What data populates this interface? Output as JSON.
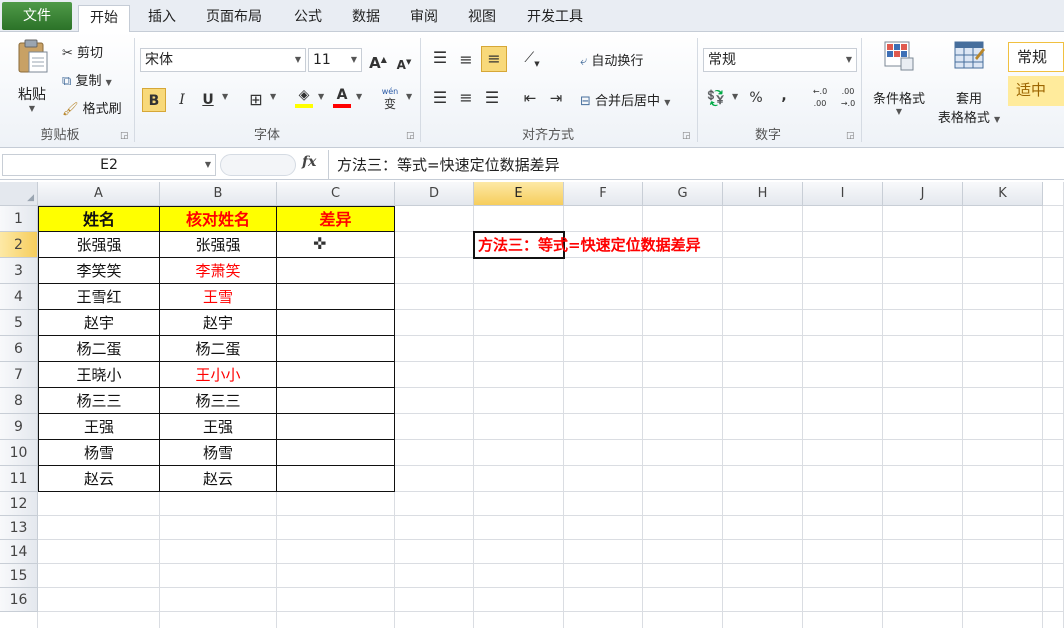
{
  "tabs": [
    "文件",
    "开始",
    "插入",
    "页面布局",
    "公式",
    "数据",
    "审阅",
    "视图",
    "开发工具"
  ],
  "clipboard": {
    "paste": "粘贴",
    "cut": "剪切",
    "copy": "复制",
    "format_painter": "格式刷",
    "group": "剪贴板"
  },
  "font": {
    "name": "宋体",
    "size": "11",
    "bold": "B",
    "italic": "I",
    "underline": "U",
    "group": "字体",
    "grow": "A",
    "shrink": "A",
    "color_letter": "A",
    "wen": "wén",
    "wen_char": "变"
  },
  "alignment": {
    "wrap": "自动换行",
    "merge": "合并后居中",
    "group": "对齐方式"
  },
  "number": {
    "format": "常规",
    "percent": "%",
    "comma": ",",
    "inc_decimal": "←.0 .00",
    "dec_decimal": ".00 →.0",
    "group": "数字"
  },
  "styles": {
    "conditional": "条件格式",
    "table_format_1": "套用",
    "table_format_2": "表格格式",
    "style_normal": "常规",
    "style_neutral": "适中"
  },
  "formula_bar": {
    "name_box": "E2",
    "fx": "fx",
    "content": "方法三：等式=快速定位数据差异"
  },
  "columns": [
    "A",
    "B",
    "C",
    "D",
    "E",
    "F",
    "G",
    "H",
    "I",
    "J",
    "K"
  ],
  "rows": [
    "1",
    "2",
    "3",
    "4",
    "5",
    "6",
    "7",
    "8",
    "9",
    "10",
    "11",
    "12",
    "13",
    "14",
    "15",
    "16"
  ],
  "table": {
    "headers": [
      "姓名",
      "核对姓名",
      "差异"
    ],
    "rows": [
      [
        "张强强",
        "张强强",
        ""
      ],
      [
        "李笑笑",
        "李萧笑",
        ""
      ],
      [
        "王雪红",
        "王雪",
        ""
      ],
      [
        "赵宇",
        "赵宇",
        ""
      ],
      [
        "杨二蛋",
        "杨二蛋",
        ""
      ],
      [
        "王晓小",
        "王小小",
        ""
      ],
      [
        "杨三三",
        "杨三三",
        ""
      ],
      [
        "王强",
        "王强",
        ""
      ],
      [
        "杨雪",
        "杨雪",
        ""
      ],
      [
        "赵云",
        "赵云",
        ""
      ]
    ],
    "diff_rows": [
      1,
      2,
      5
    ]
  },
  "note": "方法三：等式=快速定位数据差异",
  "colors": {
    "header_fill": "#ffff00",
    "red": "#ff0000",
    "selected_header": "#f6cd5c",
    "file_tab": "#2b7228"
  }
}
